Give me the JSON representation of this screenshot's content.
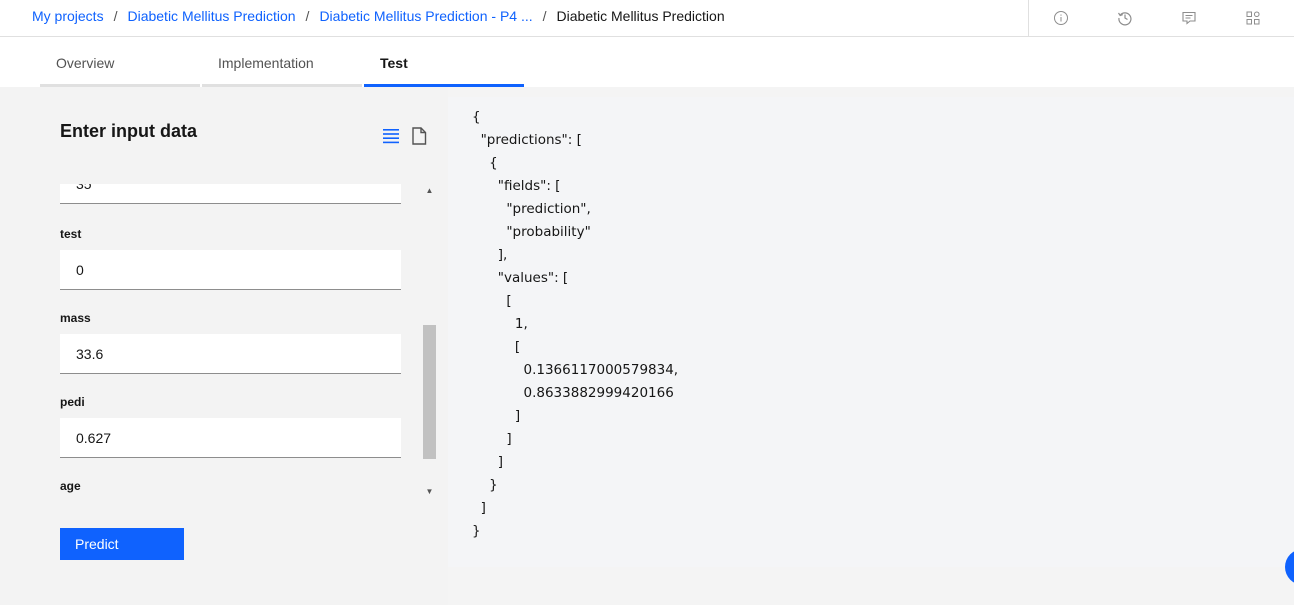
{
  "breadcrumb": {
    "items": [
      "My projects",
      "Diabetic Mellitus Prediction",
      "Diabetic Mellitus Prediction - P4 ..."
    ],
    "separator": "/",
    "current": "Diabetic Mellitus Prediction"
  },
  "top_actions": [
    "info-icon",
    "history-icon",
    "comment-icon",
    "apps-icon"
  ],
  "tabs": [
    {
      "label": "Overview",
      "active": false
    },
    {
      "label": "Implementation",
      "active": false
    },
    {
      "label": "Test",
      "active": true
    }
  ],
  "input_panel": {
    "title": "Enter input data",
    "fields": [
      {
        "label": "",
        "value": "35"
      },
      {
        "label": "test",
        "value": "0"
      },
      {
        "label": "mass",
        "value": "33.6"
      },
      {
        "label": "pedi",
        "value": "0.627"
      },
      {
        "label": "age",
        "value": ""
      }
    ],
    "predict_label": "Predict"
  },
  "result": {
    "json_text": "{\n  \"predictions\": [\n    {\n      \"fields\": [\n        \"prediction\",\n        \"probability\"\n      ],\n      \"values\": [\n        [\n          1,\n          [\n            0.1366117000579834,\n            0.8633882999420166\n          ]\n        ]\n      ]\n    }\n  ]\n}"
  },
  "colors": {
    "accent": "#0f62fe",
    "panel_bg": "#f3f3f3",
    "result_bg": "#f4f5f7"
  }
}
